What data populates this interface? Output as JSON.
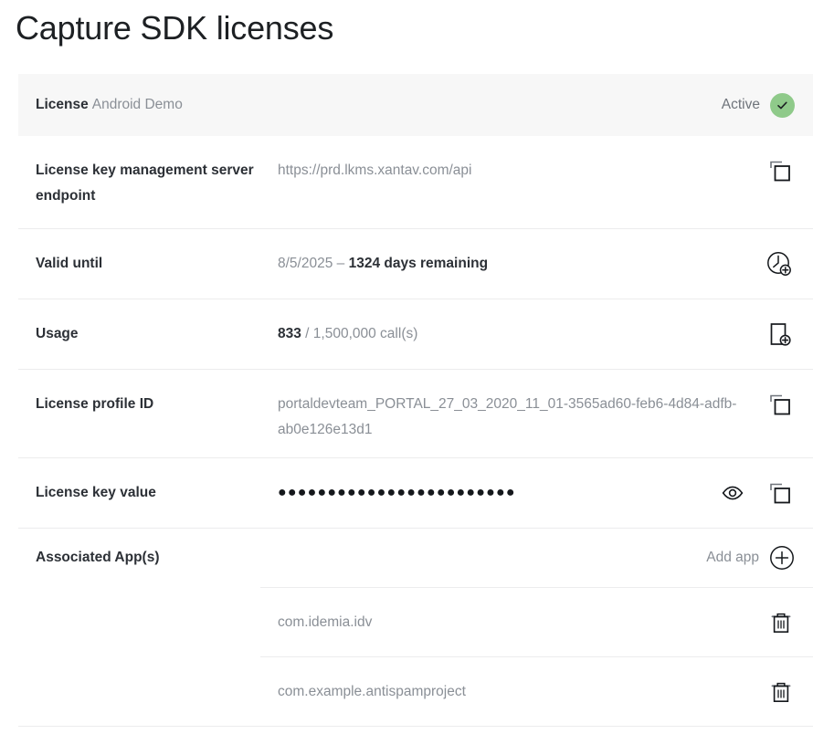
{
  "page": {
    "title": "Capture SDK licenses"
  },
  "license_card": {
    "header": {
      "label": "License",
      "name": "Android Demo",
      "status_text": "Active",
      "status_color": "#8fca8a",
      "status_icon": "check-icon"
    },
    "rows": [
      {
        "label": "License key management server endpoint",
        "value": "https://prd.lkms.xantav.com/api",
        "actions": [
          "copy-icon"
        ]
      },
      {
        "label": "Valid until",
        "value_plain": "8/5/2025 – ",
        "value_strong": "1324 days remaining",
        "actions": [
          "clock-add-icon"
        ]
      },
      {
        "label": "Usage",
        "value_strong": "833",
        "value_plain": " / 1,500,000 call(s)",
        "actions": [
          "page-add-icon"
        ]
      },
      {
        "label": "License profile ID",
        "value": "portaldevteam_PORTAL_27_03_2020_11_01-3565ad60-feb6-4d84-adfb-ab0e126e13d1",
        "actions": [
          "copy-icon"
        ]
      },
      {
        "label": "License key value",
        "value_masked": "●●●●●●●●●●●●●●●●●●●●●●●●",
        "actions": [
          "eye-icon",
          "copy-icon"
        ]
      }
    ],
    "associated_apps": {
      "label": "Associated App(s)",
      "add_label": "Add app",
      "add_icon": "plus-circle-icon",
      "items": [
        {
          "name": "com.idemia.idv",
          "action_icon": "trash-icon"
        },
        {
          "name": "com.example.antispamproject",
          "action_icon": "trash-icon"
        }
      ]
    }
  }
}
